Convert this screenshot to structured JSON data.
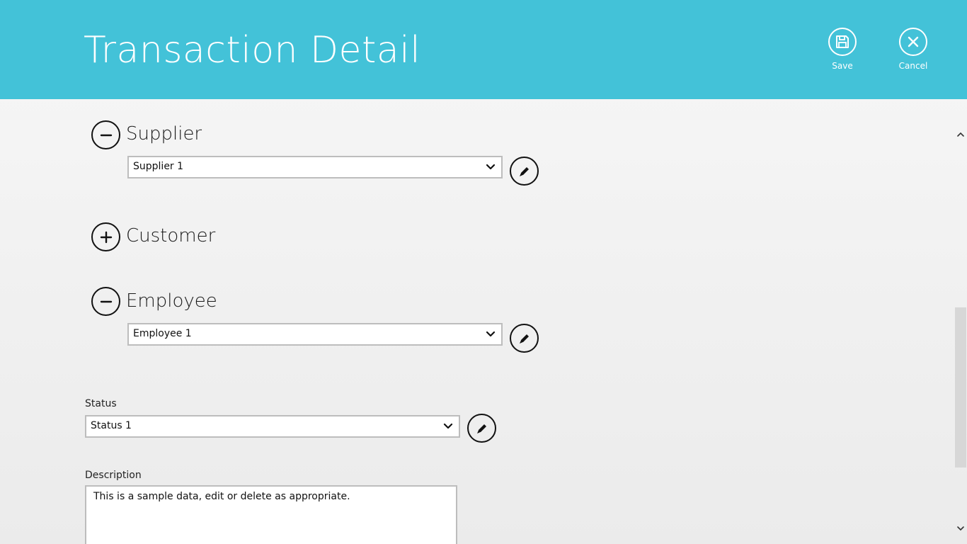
{
  "header": {
    "title": "Transaction Detail",
    "background_color": "#43c2d8",
    "save_label": "Save",
    "cancel_label": "Cancel",
    "save_icon": "save-icon",
    "cancel_icon": "close-icon"
  },
  "sections": {
    "supplier": {
      "title": "Supplier",
      "state": "expanded",
      "selected": "Supplier 1",
      "toggle_icon": "minus-icon",
      "edit_icon": "pencil-icon"
    },
    "customer": {
      "title": "Customer",
      "state": "collapsed",
      "toggle_icon": "plus-icon"
    },
    "employee": {
      "title": "Employee",
      "state": "expanded",
      "selected": "Employee 1",
      "toggle_icon": "minus-icon",
      "edit_icon": "pencil-icon"
    }
  },
  "status": {
    "label": "Status",
    "selected": "Status 1",
    "edit_icon": "pencil-icon"
  },
  "description": {
    "label": "Description",
    "value": "This is a sample data, edit or delete as appropriate."
  },
  "scrollbar": {
    "up_icon": "chevron-up-icon",
    "down_icon": "chevron-down-icon"
  }
}
